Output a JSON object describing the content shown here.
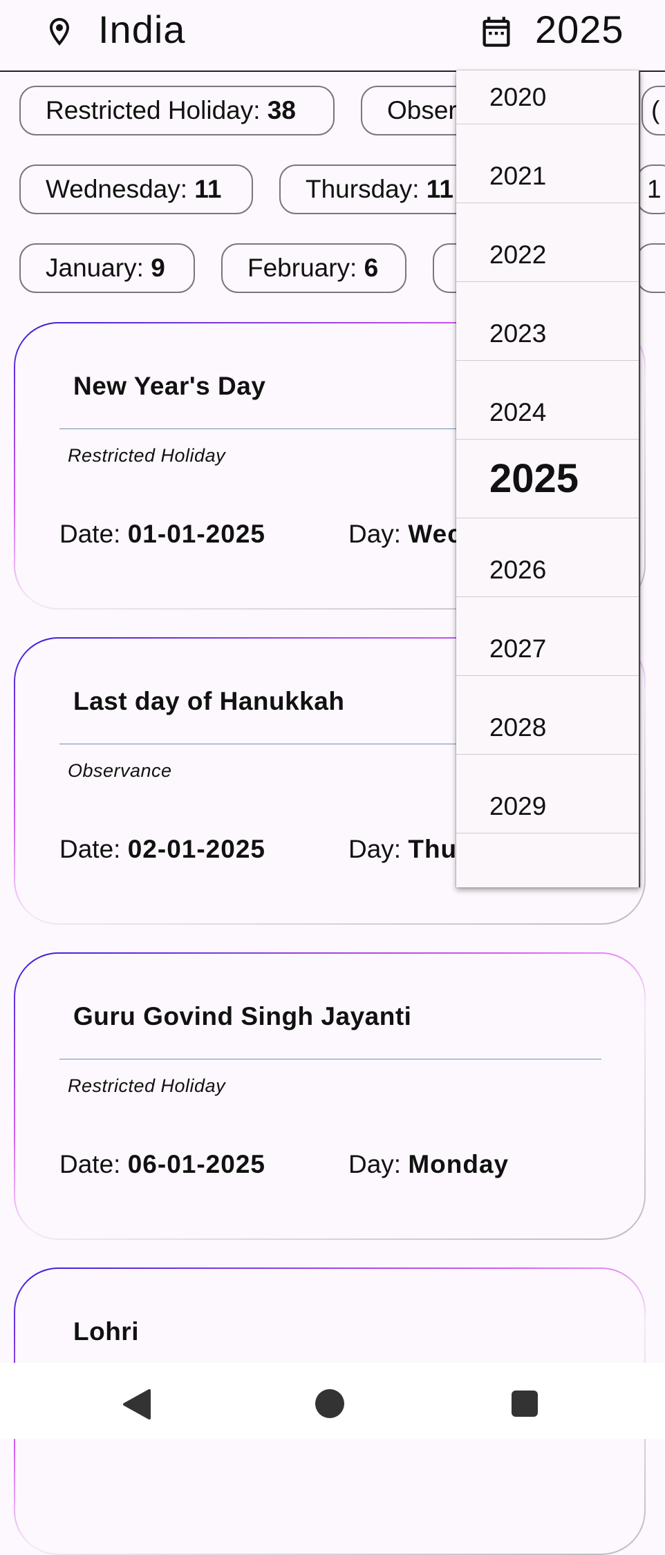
{
  "header": {
    "location_icon": "map-pin-icon",
    "country": "India",
    "calendar_icon": "calendar-icon",
    "year": "2025"
  },
  "chips_row1": [
    {
      "label": "Restricted Holiday: ",
      "value": "38"
    },
    {
      "label": "Obser",
      "value": ""
    },
    {
      "label": "(",
      "value": ""
    }
  ],
  "chips_row2": [
    {
      "label": "Wednesday: ",
      "value": "11"
    },
    {
      "label": "Thursday: ",
      "value": "11"
    },
    {
      "label": "1",
      "value": ""
    }
  ],
  "chips_row3": [
    {
      "label": "January: ",
      "value": "9"
    },
    {
      "label": "February: ",
      "value": "6"
    }
  ],
  "cards": [
    {
      "title": "New Year's Day",
      "type": "Restricted Holiday",
      "date_label": "Date: ",
      "date": "01-01-2025",
      "day_label": "Day: ",
      "day": "Wec"
    },
    {
      "title": "Last day of Hanukkah",
      "type": "Observance",
      "date_label": "Date: ",
      "date": "02-01-2025",
      "day_label": "Day: ",
      "day": "Thu"
    },
    {
      "title": "Guru Govind Singh Jayanti",
      "type": "Restricted Holiday",
      "date_label": "Date: ",
      "date": "06-01-2025",
      "day_label": "Day: ",
      "day": "Monday"
    },
    {
      "title": "Lohri"
    }
  ],
  "year_dropdown": {
    "options": [
      "2020",
      "2021",
      "2022",
      "2023",
      "2024",
      "2025",
      "2026",
      "2027",
      "2028",
      "2029"
    ],
    "selected": "2025"
  },
  "navbar": {
    "back_icon": "back-triangle-icon",
    "home_icon": "home-circle-icon",
    "recents_icon": "recents-square-icon"
  },
  "colors": {
    "background": "#fcf8fd",
    "card_border_start": "#3a1cd8",
    "card_border_accent": "#d75bf0"
  }
}
